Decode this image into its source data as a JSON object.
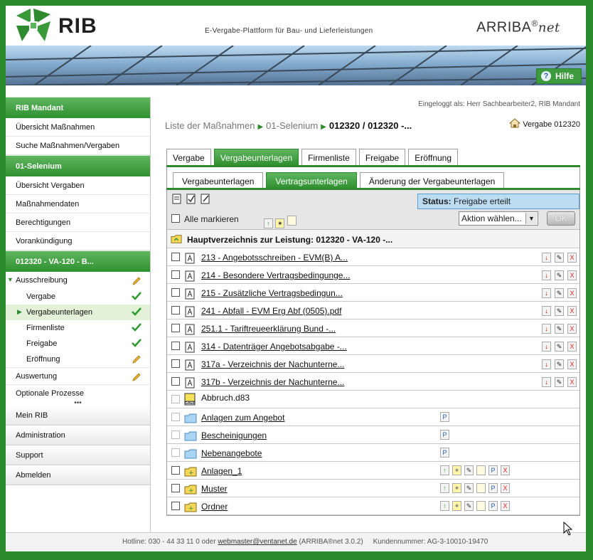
{
  "header": {
    "brand": "RIB",
    "tagline": "E-Vergabe-Plattform für Bau- und Lieferleistungen",
    "product": "ARRIBA",
    "product_reg": "®",
    "product_suffix": "net",
    "help_label": "Hilfe"
  },
  "sidebar": {
    "section1": "RIB Mandant",
    "section1_items": [
      "Übersicht Maßnahmen",
      "Suche Maßnahmen/Vergaben"
    ],
    "section2": "01-Selenium",
    "section2_items": [
      "Übersicht Vergaben",
      "Maßnahmendaten",
      "Berechtigungen",
      "Vorankündigung"
    ],
    "section3": "012320 - VA-120 - B...",
    "tree": {
      "ausschreibung": "Ausschreibung",
      "children": [
        "Vergabe",
        "Vergabeunterlagen",
        "Firmenliste",
        "Freigabe",
        "Eröffnung"
      ],
      "auswertung": "Auswertung",
      "optionale": "Optionale Prozesse"
    },
    "bottom_items": [
      "Mein RIB",
      "Administration",
      "Support",
      "Abmelden"
    ],
    "colors": {
      "accent": "#2f8a2f",
      "done": "#2f9a2f",
      "pending": "#d8a520"
    }
  },
  "main": {
    "logged_in": "Eingeloggt als: Herr Sachbearbeiter2, RIB Mandant",
    "breadcrumb": [
      "Liste der Maßnahmen",
      "01-Selenium",
      "012320 / 012320 -..."
    ],
    "vergabe_ref": "Vergabe 012320",
    "tabs": [
      "Vergabe",
      "Vergabeunterlagen",
      "Firmenliste",
      "Freigabe",
      "Eröffnung"
    ],
    "subtabs": [
      "Vergabeunterlagen",
      "Vertragsunterlagen",
      "Änderung der Vergabeunterlagen"
    ],
    "status_label": "Status:",
    "status_value": "Freigabe erteilt",
    "select_all": "Alle markieren",
    "action_placeholder": "Aktion wählen...",
    "ok_label": "OK",
    "root_folder": "Hauptverzeichnis zur Leistung: 012320 - VA-120 -...",
    "docs": [
      "213 - Angebotsschreiben - EVM(B) A...",
      "214 - Besondere Vertragsbedingunge...",
      "215 - Zusätzliche Vertragsbedingun...",
      "241 - Abfall - EVM Erg Abf (0505).pdf",
      "251.1 - Tariftreueerklärung Bund -...",
      "314 - Datenträger Angebotsabgabe -...",
      "317a - Verzeichnis der Nachunterne...",
      "317b - Verzeichnis der Nachunterne..."
    ],
    "gaeb_file": "Abbruch.d83",
    "gaeb_tag": "GAEB",
    "system_folders": [
      "Anlagen zum Angebot",
      "Bescheinigungen",
      "Nebenangebote"
    ],
    "user_folders": [
      "Anlagen_1",
      "Muster",
      "Ordner"
    ]
  },
  "footer": {
    "hotline": "Hotline: 030 - 44 33 11 0 oder",
    "email": "webmaster@ventanet.de",
    "version": "(ARRIBA®net 3.0.2)",
    "customer": "Kundennummer: AG-3-10010-19470"
  }
}
